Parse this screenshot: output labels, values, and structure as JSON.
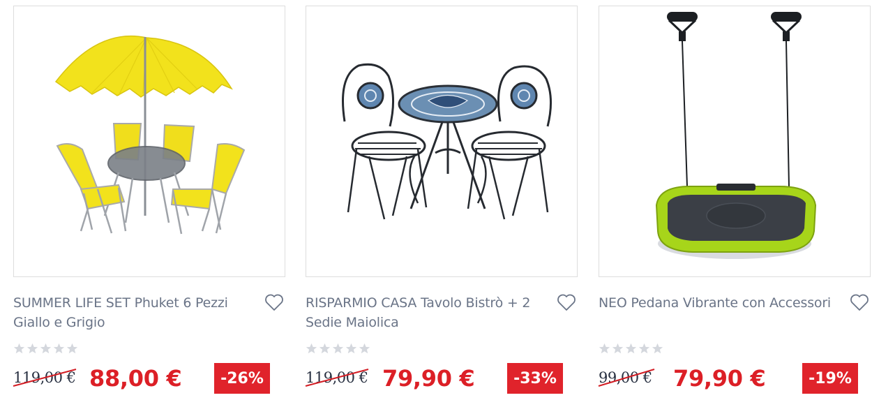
{
  "products": [
    {
      "brand_title": "SUMMER LIFE SET Phuket 6 Pezzi Giallo e Grigio",
      "old_price": "119,00 €",
      "price": "88,00 €",
      "discount": "-26%",
      "rating": 0,
      "rating_max": 5,
      "image_icon": "yellow-patio-set-with-umbrella"
    },
    {
      "brand_title": "RISPARMIO CASA Tavolo Bistrò + 2 Sedie Maiolica",
      "old_price": "119,00 €",
      "price": "79,90 €",
      "discount": "-33%",
      "rating": 0,
      "rating_max": 5,
      "image_icon": "bistro-table-with-two-chairs"
    },
    {
      "brand_title": "NEO Pedana Vibrante con Accessori",
      "old_price": "99,00 €",
      "price": "79,90 €",
      "discount": "-19%",
      "rating": 0,
      "rating_max": 5,
      "image_icon": "vibration-platform"
    }
  ],
  "colors": {
    "price": "#dc1f26",
    "badge_bg": "#e0232b",
    "title": "#6a7487",
    "old_price": "#283041",
    "star_empty": "#d4d7dd"
  }
}
